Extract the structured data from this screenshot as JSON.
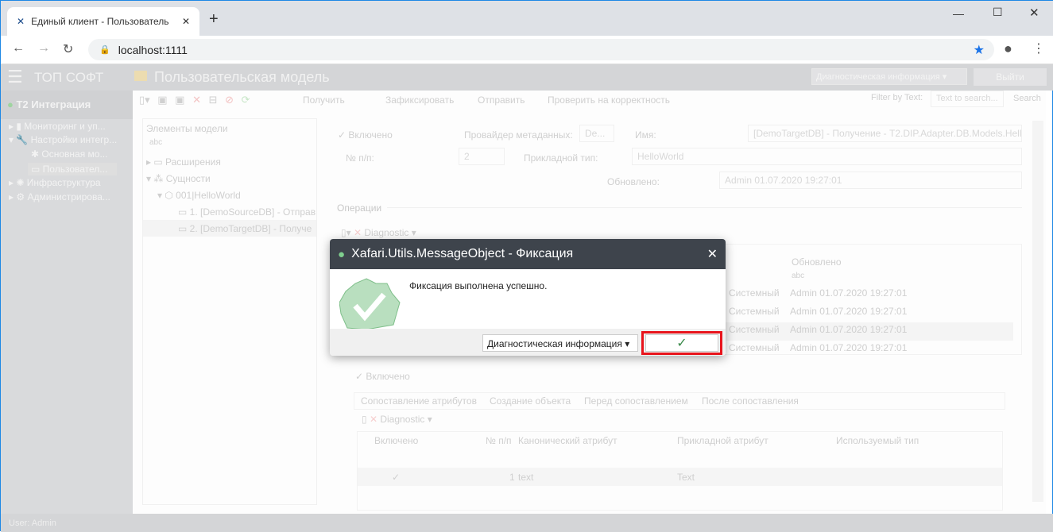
{
  "browser": {
    "tab_title": "Единый клиент - Пользователь",
    "new_tab": "+",
    "url": "localhost:1111"
  },
  "app": {
    "brand": "ТОП СОФТ",
    "page_title": "Пользовательская модель",
    "diag_select": "Диагностическая информация",
    "logout": "Выйти"
  },
  "sidebar": {
    "section": "T2 Интеграция",
    "items": [
      {
        "label": "Мониторинг и уп..."
      },
      {
        "label": "Настройки интегр..."
      },
      {
        "label": "Основная мо..."
      },
      {
        "label": "Пользовател..."
      },
      {
        "label": "Инфраструктура"
      },
      {
        "label": "Администрирова..."
      }
    ]
  },
  "toolbar": {
    "get": "Получить",
    "commit": "Зафиксировать",
    "send": "Отправить",
    "validate": "Проверить на корректность",
    "filter_label": "Filter by Text:",
    "filter_placeholder": "Text to search...",
    "search": "Search"
  },
  "tree": {
    "header": "Элементы модели",
    "filter": "abc",
    "nodes": [
      "Расширения",
      "Сущности",
      "001|HelloWorld",
      "1. [DemoSourceDB] - Отправ",
      "2. [DemoTargetDB] - Получе"
    ]
  },
  "form": {
    "enabled": "Включено",
    "provider_label": "Провайдер метаданных:",
    "provider_value": "De...",
    "name_label": "Имя:",
    "name_value": "[DemoTargetDB] - Получение - T2.DIP.Adapter.DB.Models.Hello",
    "num_label": "№ п/п:",
    "num_value": "2",
    "type_label": "Прикладной тип:",
    "type_value": "HelloWorld",
    "updated_label": "Обновлено:",
    "updated_value": "Admin 01.07.2020 19:27:01",
    "operations": "Операции",
    "diagnostic": "Diagnostic"
  },
  "ops_grid": {
    "col_updated": "Обновлено",
    "filter": "abc",
    "rows": [
      {
        "type": "Системный",
        "updated": "Admin 01.07.2020 19:27:01"
      },
      {
        "type": "Системный",
        "updated": "Admin 01.07.2020 19:27:01"
      },
      {
        "type": "Системный",
        "updated": "Admin 01.07.2020 19:27:01"
      },
      {
        "type": "Системный",
        "updated": "Admin 01.07.2020 19:27:01"
      }
    ]
  },
  "detail": {
    "enabled": "Включено",
    "tabs": [
      "Сопоставление атрибутов",
      "Создание объекта",
      "Перед сопоставлением",
      "После сопоставления"
    ],
    "diagnostic": "Diagnostic",
    "columns": [
      "Включено",
      "№ п/п",
      "Канонический атрибут",
      "Прикладной атрибут",
      "Используемый тип"
    ],
    "rows": [
      {
        "num": "1",
        "canonical": "text",
        "applied": "Text"
      }
    ]
  },
  "status": {
    "user": "User: Admin"
  },
  "modal": {
    "title": "Xafari.Utils.MessageObject - Фиксация",
    "message": "Фиксация выполнена успешно.",
    "diag_button": "Диагностическая информация",
    "ok_icon": "check-icon",
    "highlight": "#e8141c",
    "success_color": "#b9dfbf"
  }
}
